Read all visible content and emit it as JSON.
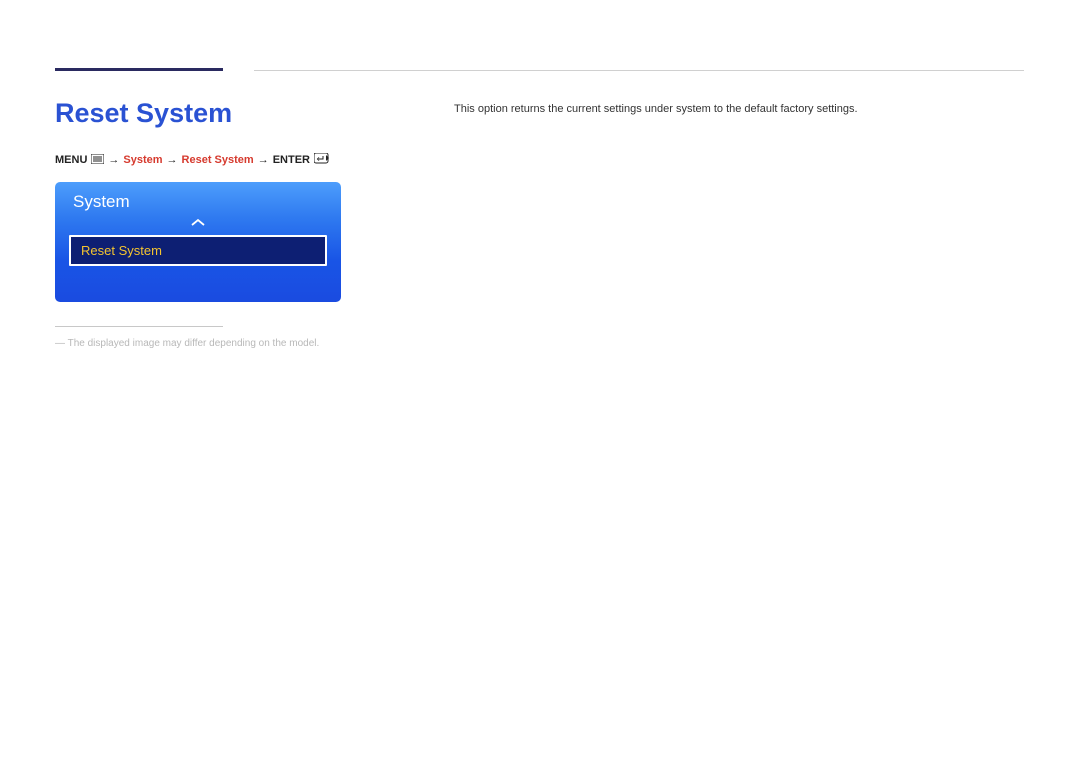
{
  "heading": "Reset System",
  "breadcrumb": {
    "menu_label": "MENU",
    "arrow": "→",
    "step1": "System",
    "step2": "Reset System",
    "enter_label": "ENTER"
  },
  "osd": {
    "title": "System",
    "selected_item": "Reset System"
  },
  "footnote": "The displayed image may differ depending on the model.",
  "description": "This option returns the current settings under system to the default factory settings."
}
